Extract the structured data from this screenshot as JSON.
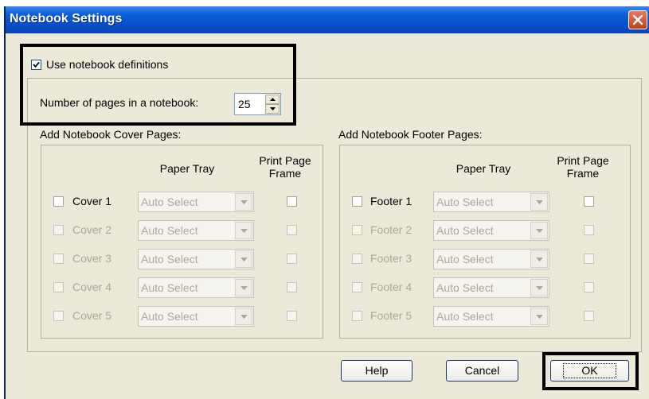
{
  "window": {
    "title": "Notebook Settings"
  },
  "use_definitions": {
    "label": "Use notebook definitions",
    "checked": true
  },
  "pages": {
    "label": "Number of pages in a notebook:",
    "value": "25"
  },
  "cover": {
    "group_label": "Add Notebook Cover Pages:",
    "col_paper_tray": "Paper Tray",
    "col_print_frame_1": "Print Page",
    "col_print_frame_2": "Frame",
    "rows": [
      {
        "label": "Cover 1",
        "tray": "Auto Select",
        "enabled": true
      },
      {
        "label": "Cover 2",
        "tray": "Auto Select",
        "enabled": false
      },
      {
        "label": "Cover 3",
        "tray": "Auto Select",
        "enabled": false
      },
      {
        "label": "Cover 4",
        "tray": "Auto Select",
        "enabled": false
      },
      {
        "label": "Cover 5",
        "tray": "Auto Select",
        "enabled": false
      }
    ]
  },
  "footer": {
    "group_label": "Add Notebook Footer Pages:",
    "col_paper_tray": "Paper Tray",
    "col_print_frame_1": "Print Page",
    "col_print_frame_2": "Frame",
    "rows": [
      {
        "label": "Footer 1",
        "tray": "Auto Select",
        "enabled": true
      },
      {
        "label": "Footer 2",
        "tray": "Auto Select",
        "enabled": false
      },
      {
        "label": "Footer 3",
        "tray": "Auto Select",
        "enabled": false
      },
      {
        "label": "Footer 4",
        "tray": "Auto Select",
        "enabled": false
      },
      {
        "label": "Footer 5",
        "tray": "Auto Select",
        "enabled": false
      }
    ]
  },
  "buttons": {
    "help": "Help",
    "cancel": "Cancel",
    "ok": "OK"
  },
  "icons": {
    "close": "close-icon",
    "checkmark": "checkmark-icon",
    "dropdown": "chevron-down-icon"
  },
  "colors": {
    "titlebar": "#0a5fd8",
    "close_button": "#c0401e",
    "dialog_bg": "#ece9d8"
  }
}
